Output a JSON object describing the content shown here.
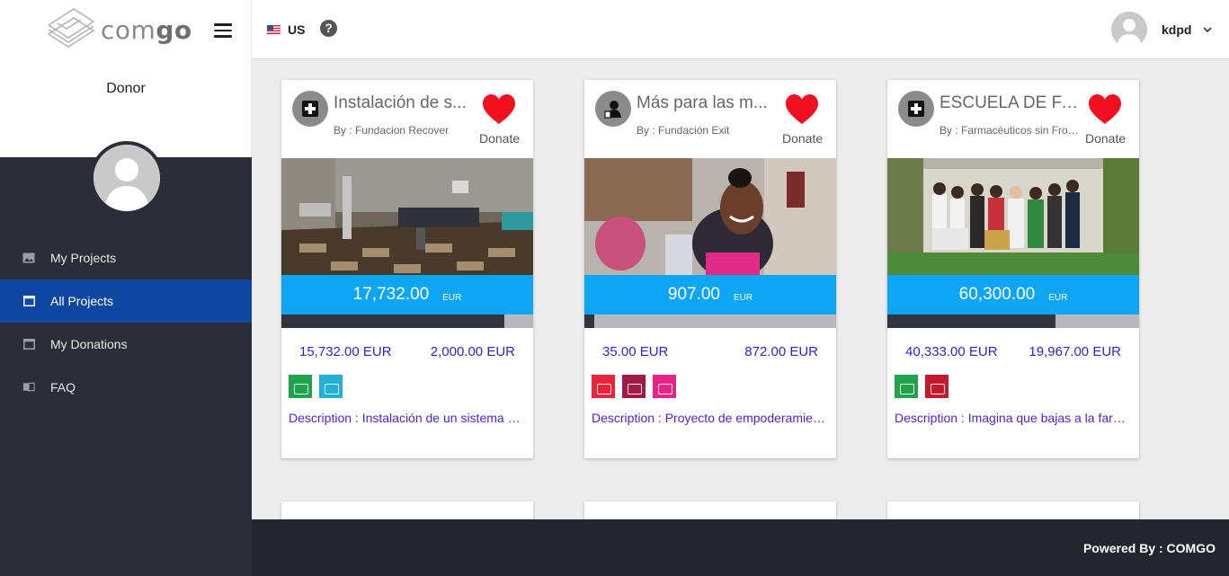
{
  "app": {
    "logo_text_a": "com",
    "logo_text_b": "go",
    "role": "Donor"
  },
  "nav": {
    "items": [
      {
        "label": "My Projects",
        "icon": "image-icon",
        "active": false
      },
      {
        "label": "All Projects",
        "icon": "browser-window-icon",
        "active": true
      },
      {
        "label": "My Donations",
        "icon": "browser-window-icon",
        "active": false
      },
      {
        "label": "FAQ",
        "icon": "book-icon",
        "active": false
      }
    ]
  },
  "header": {
    "country": "US",
    "help_symbol": "?",
    "username": "kdpd"
  },
  "cards": [
    {
      "title": "Instalación de s...",
      "by": "By : Fundacion Recover",
      "donate_label": "Donate",
      "category_icon": "medical-cross-icon",
      "amount": "17,732.00",
      "currency": "EUR",
      "funded_fraction": 0.887,
      "raised": "15,732.00 EUR",
      "remaining": "2,000.00 EUR",
      "sdg_colors": [
        "#21a34a",
        "#22b0d8"
      ],
      "description": "Description : Instalación de un sistema de energía solar",
      "image_scene": "hospital-room"
    },
    {
      "title": "Más para las m...",
      "by": "By : Fundación Exit",
      "donate_label": "Donate",
      "category_icon": "person-icon",
      "amount": "907.00",
      "currency": "EUR",
      "funded_fraction": 0.039,
      "raised": "35.00 EUR",
      "remaining": "872.00 EUR",
      "sdg_colors": [
        "#e8233a",
        "#a01a48",
        "#e62388"
      ],
      "description": "Description : Proyecto de empoderamiento de mujeres",
      "image_scene": "woman-portrait"
    },
    {
      "title": "ESCUELA DE FA...",
      "by": "By : Farmacéuticos sin Fronteras",
      "donate_label": "Donate",
      "category_icon": "medical-cross-icon",
      "amount": "60,300.00",
      "currency": "EUR",
      "funded_fraction": 0.669,
      "raised": "40,333.00 EUR",
      "remaining": "19,967.00 EUR",
      "sdg_colors": [
        "#21a34a",
        "#c5192d"
      ],
      "description": "Description : Imagina que bajas a la farmacia",
      "image_scene": "group-photo"
    }
  ],
  "footer": {
    "powered_by": "Powered By : COMGO"
  },
  "colors": {
    "sidebar_bg": "#2b2e38",
    "nav_active": "#0d47a1",
    "amount_bar": "#0ea5f5",
    "link": "#3d1ad6",
    "heart": "#f2101e"
  }
}
